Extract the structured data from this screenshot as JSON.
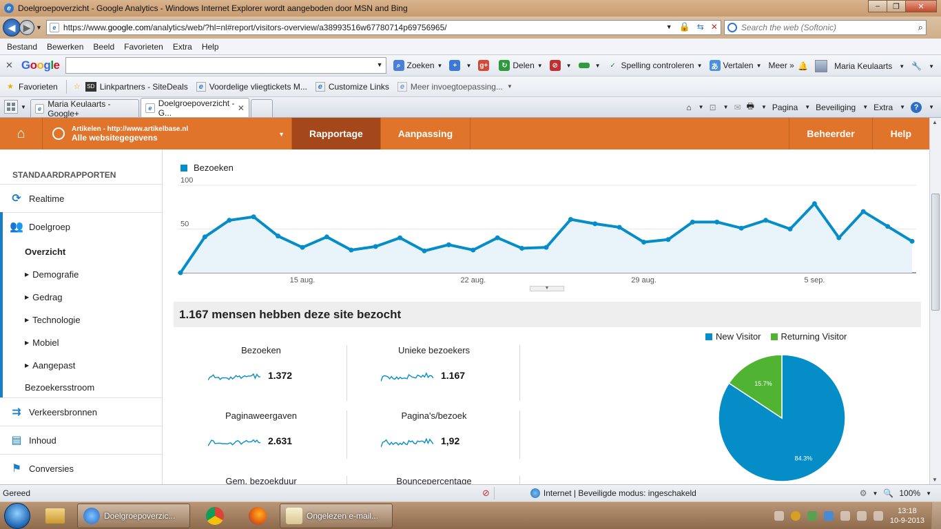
{
  "window": {
    "title": "Doelgroepoverzicht - Google Analytics - Windows Internet Explorer wordt aangeboden door MSN and Bing",
    "buttons": [
      "–",
      "❐",
      "✕"
    ]
  },
  "address": {
    "url_prefix": "https://www.",
    "url_domain": "google.com",
    "url_rest": "/analytics/web/?hl=nl#report/visitors-overview/a38993516w67780714p69756965/",
    "search_placeholder": "Search the web (Softonic)"
  },
  "menu": [
    "Bestand",
    "Bewerken",
    "Beeld",
    "Favorieten",
    "Extra",
    "Help"
  ],
  "google_toolbar": {
    "logo": [
      "G",
      "o",
      "o",
      "g",
      "l",
      "e"
    ],
    "tools": [
      {
        "label": "Zoeken",
        "icon": "search-icon"
      },
      {
        "label": "",
        "icon": "plus-icon"
      },
      {
        "label": "",
        "icon": "google-plus-icon"
      },
      {
        "label": "Delen",
        "icon": "share-icon"
      },
      {
        "label": "",
        "icon": "popup-blocker-icon"
      },
      {
        "label": "",
        "icon": "green-bar-icon"
      },
      {
        "label": "Spelling controleren",
        "icon": "spellcheck-icon"
      },
      {
        "label": "Vertalen",
        "icon": "translate-icon"
      },
      {
        "label": "Meer »",
        "icon": ""
      }
    ],
    "user": "Maria Keulaarts"
  },
  "favorites": {
    "label": "Favorieten",
    "items": [
      {
        "label": "Linkpartners - SiteDeals"
      },
      {
        "label": "Voordelige vliegtickets M..."
      },
      {
        "label": "Customize Links"
      },
      {
        "label": "Meer invoegtoepassing..."
      }
    ]
  },
  "tabs": [
    {
      "label": "Maria Keulaarts - Google+",
      "active": false
    },
    {
      "label": "Doelgroepoverzicht - G...",
      "active": true
    }
  ],
  "command_bar": [
    "Pagina",
    "Beveiliging",
    "Extra"
  ],
  "ga_nav": {
    "account_line1": "Artikelen - http://www.artikelbase.nl",
    "account_line2": "Alle websitegegevens",
    "tabs": [
      "Rapportage",
      "Aanpassing"
    ],
    "right_tabs": [
      "Beheerder",
      "Help"
    ]
  },
  "sidebar": {
    "heading": "STANDAARDRAPPORTEN",
    "realtime": "Realtime",
    "doelgroep": "Doelgroep",
    "doelgroep_sub": [
      {
        "label": "Overzicht",
        "bold": true,
        "arrow": false
      },
      {
        "label": "Demografie",
        "bold": false,
        "arrow": true
      },
      {
        "label": "Gedrag",
        "bold": false,
        "arrow": true
      },
      {
        "label": "Technologie",
        "bold": false,
        "arrow": true
      },
      {
        "label": "Mobiel",
        "bold": false,
        "arrow": true
      },
      {
        "label": "Aangepast",
        "bold": false,
        "arrow": true
      },
      {
        "label": "Bezoekersstroom",
        "bold": false,
        "arrow": false
      }
    ],
    "others": [
      {
        "label": "Verkeersbronnen",
        "icon": "traffic-arrows-icon"
      },
      {
        "label": "Inhoud",
        "icon": "content-icon"
      },
      {
        "label": "Conversies",
        "icon": "flag-icon"
      }
    ]
  },
  "chart_data": [
    {
      "type": "line",
      "legend": "Bezoeken",
      "y_ticks": [
        "100",
        "50"
      ],
      "ylim": [
        0,
        100
      ],
      "x_labels": [
        "15 aug.",
        "22 aug.",
        "29 aug.",
        "5 sep."
      ],
      "x_label_index": [
        5,
        12,
        19,
        26
      ],
      "series": [
        {
          "name": "Bezoeken",
          "color": "#058dc7",
          "values": [
            0,
            41,
            60,
            64,
            42,
            29,
            41,
            26,
            30,
            40,
            25,
            32,
            26,
            40,
            28,
            29,
            61,
            56,
            52,
            35,
            38,
            58,
            58,
            51,
            60,
            50,
            79,
            40,
            70,
            53,
            36
          ]
        }
      ]
    },
    {
      "type": "pie",
      "legend": [
        "New Visitor",
        "Returning Visitor"
      ],
      "values": [
        84.3,
        15.7
      ],
      "labels": [
        "84.3%",
        "15.7%"
      ],
      "colors": [
        "#058dc7",
        "#50b432"
      ]
    }
  ],
  "summary": {
    "title": "1.167 mensen hebben deze site bezocht",
    "metrics": [
      {
        "label": "Bezoeken",
        "value": "1.372"
      },
      {
        "label": "Unieke bezoekers",
        "value": "1.167"
      },
      {
        "label": "Paginaweergaven",
        "value": "2.631"
      },
      {
        "label": "Pagina's/bezoek",
        "value": "1,92"
      },
      {
        "label": "Gem. bezoekduur",
        "value": ""
      },
      {
        "label": "Bouncepercentage",
        "value": ""
      }
    ]
  },
  "statusbar": {
    "ready": "Gereed",
    "zone": "Internet | Beveiligde modus: ingeschakeld",
    "zoom": "100%"
  },
  "taskbar": {
    "buttons": [
      "Doelgroepoverzic...",
      "Ongelezen e-mail..."
    ],
    "time": "13:18",
    "date": "10-9-2013"
  }
}
